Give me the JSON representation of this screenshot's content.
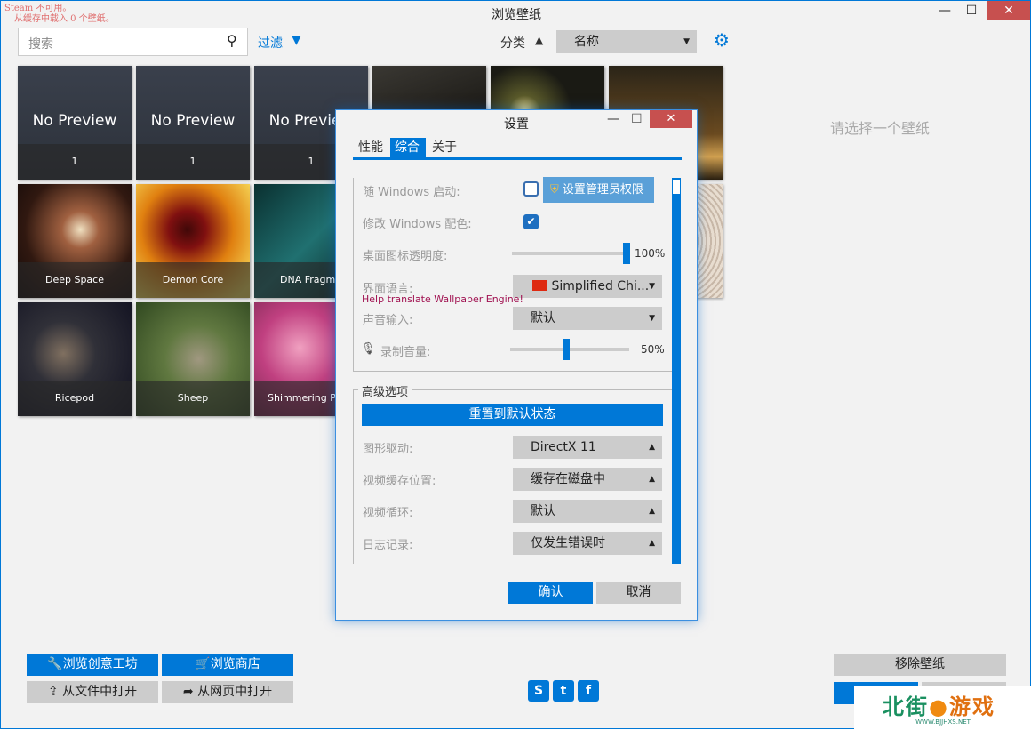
{
  "status": {
    "line1": "Steam 不可用。",
    "line2": "从缓存中载入 0 个壁纸。"
  },
  "title": "浏览壁纸",
  "window_controls": {
    "minimize": "—",
    "maximize": "☐",
    "close": "✕"
  },
  "toolbar": {
    "search_placeholder": "搜索",
    "filter": "过滤",
    "sort_label": "分类",
    "sort_value": "名称"
  },
  "wallpapers": [
    {
      "title": "No Preview",
      "count": "1"
    },
    {
      "title": "No Preview",
      "count": "1"
    },
    {
      "title": "No Preview",
      "count": "1"
    },
    {
      "title": "Deep Space"
    },
    {
      "title": "Demon Core"
    },
    {
      "title": "DNA Fragment"
    },
    {
      "title": "Ricepod"
    },
    {
      "title": "Sheep"
    },
    {
      "title": "Shimmering Particles"
    }
  ],
  "right_panel": {
    "placeholder": "请选择一个壁纸",
    "remove": "移除壁纸"
  },
  "bottom": {
    "workshop": "浏览创意工坊",
    "store": "浏览商店",
    "open_file": "从文件中打开",
    "open_web": "从网页中打开"
  },
  "watermark": {
    "name": "北街游戏",
    "url": "WWW.BJJHXS.NET"
  },
  "dialog": {
    "title": "设置",
    "tabs": [
      "性能",
      "综合",
      "关于"
    ],
    "startup_label": "随 Windows 启动:",
    "admin_button": "设置管理员权限",
    "color_label": "修改 Windows 配色:",
    "opacity_label": "桌面图标透明度:",
    "opacity_value": "100%",
    "opacity": 1.0,
    "lang_label": "界面语言:",
    "lang_value": "Simplified Chi...",
    "translate_link": "Help translate Wallpaper Engine!",
    "audio_label": "声音输入:",
    "audio_value": "默认",
    "record_label": "录制音量:",
    "record_value": "50%",
    "record": 0.5,
    "advanced": "高级选项",
    "reset": "重置到默认状态",
    "gpu_label": "图形驱动:",
    "gpu_value": "DirectX 11",
    "cache_label": "视频缓存位置:",
    "cache_value": "缓存在磁盘中",
    "loop_label": "视频循环:",
    "loop_value": "默认",
    "log_label": "日志记录:",
    "log_value": "仅发生错误时",
    "ok": "确认",
    "cancel": "取消"
  }
}
